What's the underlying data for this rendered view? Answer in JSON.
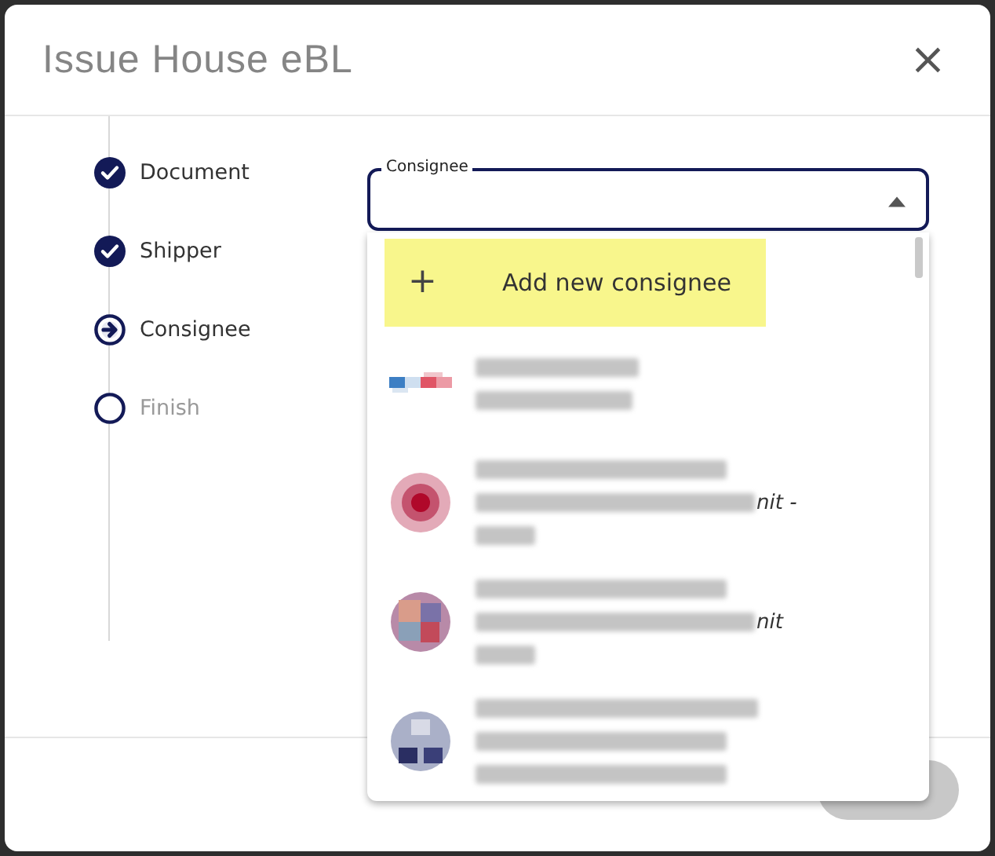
{
  "dialog": {
    "title": "Issue House eBL",
    "close": "×"
  },
  "steps": [
    {
      "label": "Document",
      "completed": true,
      "current": false
    },
    {
      "label": "Shipper",
      "completed": true,
      "current": false
    },
    {
      "label": "Consignee",
      "completed": false,
      "current": true
    },
    {
      "label": "Finish",
      "completed": false,
      "current": false
    }
  ],
  "field": {
    "label": "Consignee",
    "expanded": true
  },
  "dropdown": {
    "add": {
      "icon": "+",
      "label": "Add new consignee",
      "selected": true
    },
    "options": [
      {
        "lines": [
          {
            "kind": "mid"
          },
          {
            "kind": "short"
          }
        ]
      },
      {
        "lines": [
          {
            "kind": "long"
          },
          {
            "kind": "longer",
            "tail": "nit -"
          },
          {
            "kind": "tiny"
          }
        ]
      },
      {
        "lines": [
          {
            "kind": "long"
          },
          {
            "kind": "longer",
            "tail": "nit"
          },
          {
            "kind": "tiny"
          }
        ]
      },
      {
        "lines": [
          {
            "kind": "longest"
          },
          {
            "kind": "long"
          },
          {
            "kind": "long"
          }
        ]
      }
    ]
  },
  "footer": {
    "next": {
      "disabled": true
    }
  }
}
